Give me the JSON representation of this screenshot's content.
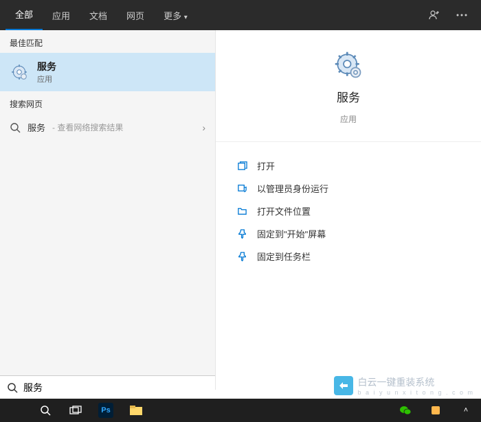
{
  "tabs": {
    "all": "全部",
    "apps": "应用",
    "docs": "文档",
    "web": "网页",
    "more": "更多"
  },
  "sections": {
    "best_match": "最佳匹配",
    "web_search": "搜索网页"
  },
  "best_match": {
    "title": "服务",
    "subtitle": "应用"
  },
  "web_result": {
    "term": "服务",
    "hint": "- 查看网络搜索结果"
  },
  "detail": {
    "title": "服务",
    "subtitle": "应用"
  },
  "actions": {
    "open": "打开",
    "run_admin": "以管理员身份运行",
    "open_location": "打开文件位置",
    "pin_start": "固定到\"开始\"屏幕",
    "pin_taskbar": "固定到任务栏"
  },
  "search": {
    "value": "服务"
  },
  "watermark": {
    "text": "白云一键重装系统",
    "sub": "b a i y u n x i t o n g . c o m"
  },
  "taskbar": {
    "ps": "Ps"
  }
}
